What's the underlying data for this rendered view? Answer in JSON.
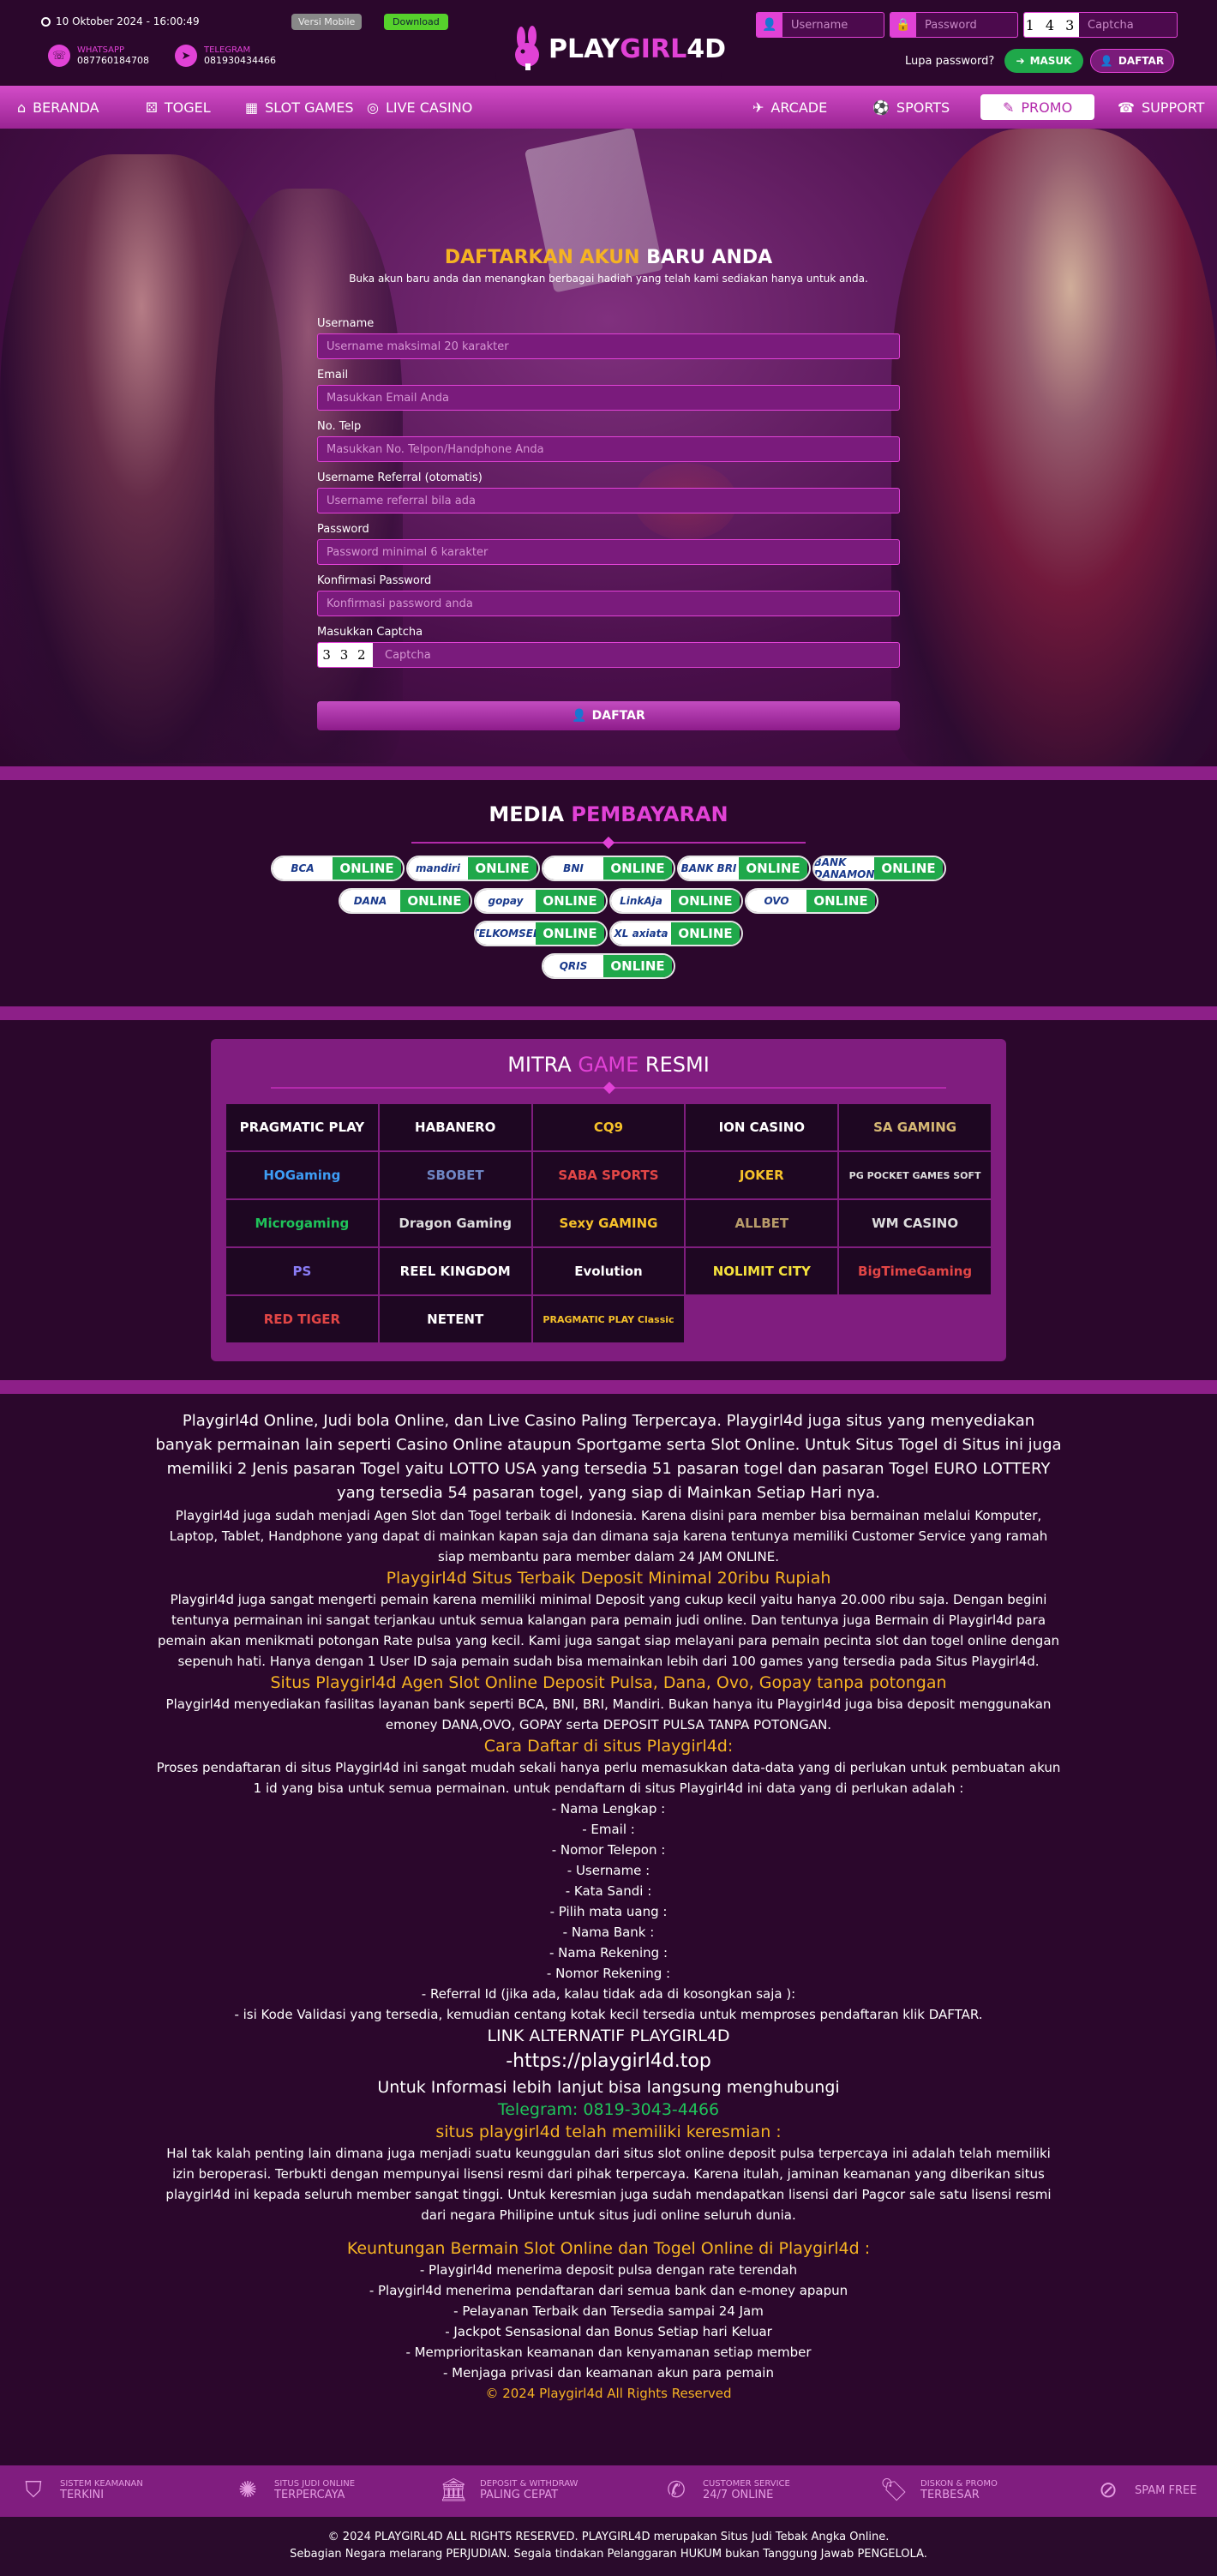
{
  "header": {
    "datetime": "10 Oktober 2024 - 16:00:49",
    "versi_mobile": "Versi Mobile",
    "download": "Download",
    "whatsapp_label": "WHATSAPP",
    "whatsapp_value": "087760184708",
    "telegram_label": "TELEGRAM",
    "telegram_value": "081930434466",
    "logo_prefix": "PLAY",
    "logo_mid": "GIRL",
    "logo_suffix": "4D",
    "username_placeholder": "Username",
    "password_placeholder": "Password",
    "captcha_code": "1 4 3",
    "captcha_placeholder": "Captcha",
    "lupa_password": "Lupa password?",
    "masuk": "MASUK",
    "daftar": "DAFTAR"
  },
  "nav": [
    {
      "label": "BERANDA",
      "icon": "home-icon"
    },
    {
      "label": "TOGEL",
      "icon": "dice-icon"
    },
    {
      "label": "SLOT GAMES",
      "icon": "slot-icon"
    },
    {
      "label": "LIVE CASINO",
      "icon": "chip-icon"
    },
    {
      "label": "ARCADE",
      "icon": "rocket-icon"
    },
    {
      "label": "SPORTS",
      "icon": "soccer-icon"
    },
    {
      "label": "PROMO",
      "icon": "tag-icon"
    },
    {
      "label": "SUPPORT",
      "icon": "support-icon"
    }
  ],
  "register": {
    "title_highlight": "DAFTARKAN AKUN",
    "title_rest": " BARU ANDA",
    "subtitle": "Buka akun baru anda dan menangkan berbagai hadiah yang telah kami sediakan hanya untuk anda.",
    "fields": [
      {
        "label": "Username",
        "placeholder": "Username maksimal 20 karakter"
      },
      {
        "label": "Email",
        "placeholder": "Masukkan Email Anda"
      },
      {
        "label": "No. Telp",
        "placeholder": "Masukkan No. Telpon/Handphone Anda"
      },
      {
        "label": "Username Referral (otomatis)",
        "placeholder": "Username referral bila ada"
      },
      {
        "label": "Password",
        "placeholder": "Password minimal 6 karakter"
      },
      {
        "label": "Konfirmasi Password",
        "placeholder": "Konfirmasi password anda"
      }
    ],
    "captcha_label": "Masukkan Captcha",
    "captcha_code": "3 3 2",
    "captcha_placeholder": "Captcha",
    "button": "DAFTAR"
  },
  "payment": {
    "title_a": "MEDIA ",
    "title_b": "PEMBAYARAN",
    "status": "ONLINE",
    "banks": [
      "BCA",
      "mandiri",
      "BNI",
      "BANK BRI",
      "BANK DANAMON",
      "DANA",
      "gopay",
      "LinkAja",
      "OVO",
      "TELKOMSEL",
      "XL axiata",
      "QRIS"
    ]
  },
  "mitra": {
    "title_a": "MITRA ",
    "title_b": "GAME",
    "title_c": " RESMI",
    "providers": [
      "PRAGMATIC PLAY",
      "HABANERO",
      "CQ9",
      "ION CASINO",
      "SA GAMING",
      "HOGaming",
      "SBOBET",
      "SABA SPORTS",
      "JOKER",
      "PG POCKET GAMES SOFT",
      "Microgaming",
      "Dragon Gaming",
      "Sexy GAMING",
      "ALLBET",
      "WM CASINO",
      "PS",
      "REEL KINGDOM",
      "Evolution",
      "NOLIMIT CITY",
      "BigTimeGaming",
      "RED TIGER",
      "NETENT",
      "PRAGMATIC PLAY Classic"
    ]
  },
  "article": {
    "lead": "Playgirl4d Online, Judi bola Online, dan Live Casino Paling Terpercaya. Playgirl4d juga situs yang menyediakan banyak permainan lain seperti Casino Online ataupun Sportgame serta Slot Online. Untuk Situs Togel di Situs ini juga memiliki 2 Jenis pasaran Togel yaitu LOTTO USA yang tersedia 51 pasaran togel dan pasaran Togel EURO LOTTERY yang tersedia 54 pasaran togel, yang siap di Mainkan Setiap Hari nya.",
    "p1": "Playgirl4d juga sudah menjadi Agen Slot dan Togel terbaik di Indonesia. Karena disini para member bisa bermainan melalui Komputer, Laptop, Tablet, Handphone yang dapat di mainkan kapan saja dan dimana saja karena tentunya memiliki Customer Service yang ramah siap membantu para member dalam 24 JAM ONLINE.",
    "h1": "Playgirl4d Situs Terbaik Deposit Minimal 20ribu Rupiah",
    "p2": "Playgirl4d juga sangat mengerti pemain karena memiliki minimal Deposit yang cukup kecil yaitu hanya 20.000 ribu saja. Dengan begini tentunya permainan ini sangat terjankau untuk semua kalangan para pemain judi online. Dan tentunya juga Bermain di Playgirl4d para pemain akan menikmati potongan Rate pulsa yang kecil. Kami juga sangat siap melayani para pemain pecinta slot dan togel online dengan sepenuh hati. Hanya dengan 1 User ID saja pemain sudah bisa memainkan lebih dari 100 games yang tersedia pada Situs Playgirl4d.",
    "h2": "Situs Playgirl4d Agen Slot Online Deposit Pulsa, Dana, Ovo, Gopay tanpa potongan",
    "p3": "Playgirl4d menyediakan fasilitas layanan bank seperti BCA, BNI, BRI, Mandiri. Bukan hanya itu Playgirl4d juga bisa deposit menggunakan emoney DANA,OVO, GOPAY serta DEPOSIT PULSA TANPA POTONGAN.",
    "h3": "Cara Daftar di situs Playgirl4d:",
    "p4": "Proses pendaftaran di situs Playgirl4d ini sangat mudah sekali hanya perlu memasukkan data-data yang di perlukan untuk pembuatan akun 1 id yang bisa untuk semua permainan. untuk pendaftarn di situs Playgirl4d ini data yang di perlukan adalah :",
    "list": [
      "- Nama Lengkap :",
      "- Email :",
      "- Nomor Telepon :",
      "- Username :",
      "- Kata Sandi :",
      "- Pilih mata uang :",
      "- Nama Bank :",
      "- Nama Rekening :",
      "- Nomor Rekening :",
      "- Referral Id (jika ada, kalau tidak ada di kosongkan saja ):",
      "- isi Kode Validasi yang tersedia, kemudian centang kotak kecil tersedia untuk memproses pendaftaran klik DAFTAR."
    ],
    "h4": "LINK ALTERNATIF PLAYGIRL4D",
    "link": "-https://playgirl4d.top",
    "h5": "Untuk Informasi lebih lanjut bisa langsung menghubungi",
    "telegram": "Telegram: 0819-3043-4466",
    "h6": "situs playgirl4d telah memiliki keresmian :",
    "p5": "Hal tak kalah penting lain dimana juga menjadi suatu keunggulan dari situs slot online deposit pulsa terpercaya ini adalah telah memiliki izin beroperasi. Terbukti dengan mempunyai lisensi resmi dari pihak terpercaya. Karena itulah, jaminan keamanan yang diberikan situs playgirl4d ini kepada seluruh member sangat tinggi. Untuk keresmian juga sudah mendapatkan lisensi dari Pagcor sale satu lisensi resmi dari negara Philipine untuk situs judi online seluruh dunia.",
    "h7": "Keuntungan Bermain Slot Online dan Togel Online di Playgirl4d :",
    "benefits": [
      "- Playgirl4d menerima deposit pulsa dengan rate terendah",
      "- Playgirl4d menerima pendaftaran dari semua bank dan e-money apapun",
      "- Pelayanan Terbaik dan Tersedia sampai 24 Jam",
      "- Jackpot Sensasional dan Bonus Setiap hari Keluar",
      "- Memprioritaskan keamanan dan kenyamanan setiap member",
      "- Menjaga privasi dan keamanan akun para pemain"
    ],
    "copyright": "© 2024 Playgirl4d All Rights Reserved"
  },
  "footer": {
    "items": [
      {
        "t1": "SISTEM KEAMANAN",
        "t2": "TERKINI"
      },
      {
        "t1": "SITUS JUDI ONLINE",
        "t2": "TERPERCAYA"
      },
      {
        "t1": "DEPOSIT & WITHDRAW",
        "t2": "PALING CEPAT"
      },
      {
        "t1": "CUSTOMER SERVICE",
        "t2": "24/7 ONLINE"
      },
      {
        "t1": "DISKON & PROMO",
        "t2": "TERBESAR"
      },
      {
        "t1": "",
        "t2": "SPAM FREE"
      }
    ],
    "copy1": "© 2024 PLAYGIRL4D ALL RIGHTS RESERVED. PLAYGIRL4D merupakan Situs Judi Tebak Angka Online.",
    "copy2": "Sebagian Negara melarang PERJUDIAN. Segala tindakan Pelanggaran HUKUM bukan Tanggung Jawab PENGELOLA."
  }
}
